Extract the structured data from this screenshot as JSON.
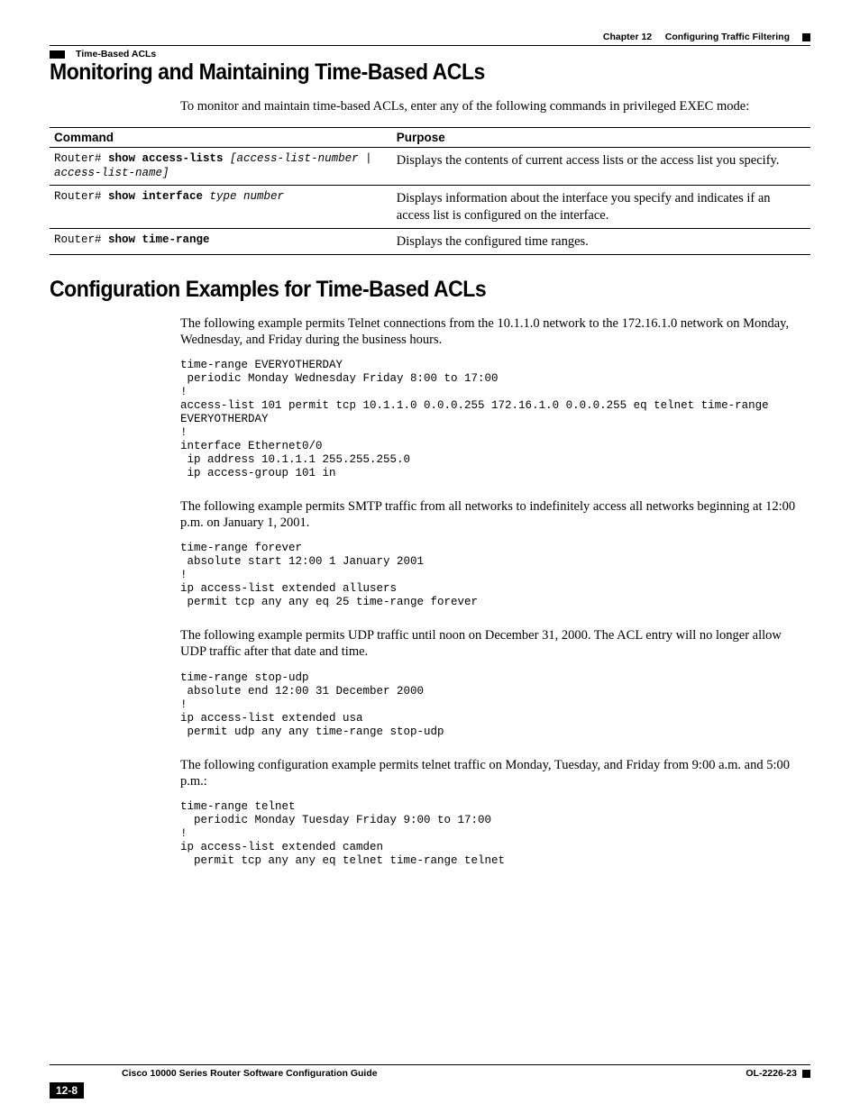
{
  "header": {
    "chapter_ref": "Chapter 12",
    "chapter_title": "Configuring Traffic Filtering",
    "section": "Time-Based ACLs"
  },
  "section1": {
    "title": "Monitoring and Maintaining Time-Based ACLs",
    "intro": "To monitor and maintain time-based ACLs, enter any of the following commands in privileged EXEC mode:",
    "table": {
      "headers": [
        "Command",
        "Purpose"
      ],
      "rows": [
        {
          "cmd_prefix": "Router# ",
          "cmd_bold": "show access-lists",
          "cmd_args": " [access-list-number | access-list-name]",
          "purpose": "Displays the contents of current access lists or the access list you specify."
        },
        {
          "cmd_prefix": "Router# ",
          "cmd_bold": "show interface",
          "cmd_args": " type number",
          "purpose": "Displays information about the interface you specify and indicates if an access list is configured on the interface."
        },
        {
          "cmd_prefix": "Router# ",
          "cmd_bold": "show time-range",
          "cmd_args": "",
          "purpose": "Displays the configured time ranges."
        }
      ]
    }
  },
  "section2": {
    "title": "Configuration Examples for Time-Based ACLs",
    "examples": [
      {
        "desc": "The following example permits Telnet connections from the 10.1.1.0 network to the 172.16.1.0 network on Monday, Wednesday, and Friday during the business hours.",
        "code": "time-range EVERYOTHERDAY\n periodic Monday Wednesday Friday 8:00 to 17:00\n!\naccess-list 101 permit tcp 10.1.1.0 0.0.0.255 172.16.1.0 0.0.0.255 eq telnet time-range\nEVERYOTHERDAY\n!\ninterface Ethernet0/0\n ip address 10.1.1.1 255.255.255.0\n ip access-group 101 in"
      },
      {
        "desc": "The following example permits SMTP traffic from all networks to indefinitely access all networks beginning at 12:00 p.m. on January 1, 2001.",
        "code": "time-range forever\n absolute start 12:00 1 January 2001\n!\nip access-list extended allusers\n permit tcp any any eq 25 time-range forever"
      },
      {
        "desc": "The following example permits UDP traffic until noon on December 31, 2000. The ACL entry will no longer allow UDP traffic after that date and time.",
        "code": "time-range stop-udp\n absolute end 12:00 31 December 2000\n!\nip access-list extended usa\n permit udp any any time-range stop-udp"
      },
      {
        "desc": "The following configuration example permits telnet traffic on Monday, Tuesday, and Friday from 9:00 a.m. and 5:00 p.m.:",
        "code": "time-range telnet\n  periodic Monday Tuesday Friday 9:00 to 17:00\n!\nip access-list extended camden\n  permit tcp any any eq telnet time-range telnet"
      }
    ]
  },
  "footer": {
    "doc_title": "Cisco 10000 Series Router Software Configuration Guide",
    "page_num": "12-8",
    "doc_id": "OL-2226-23"
  }
}
